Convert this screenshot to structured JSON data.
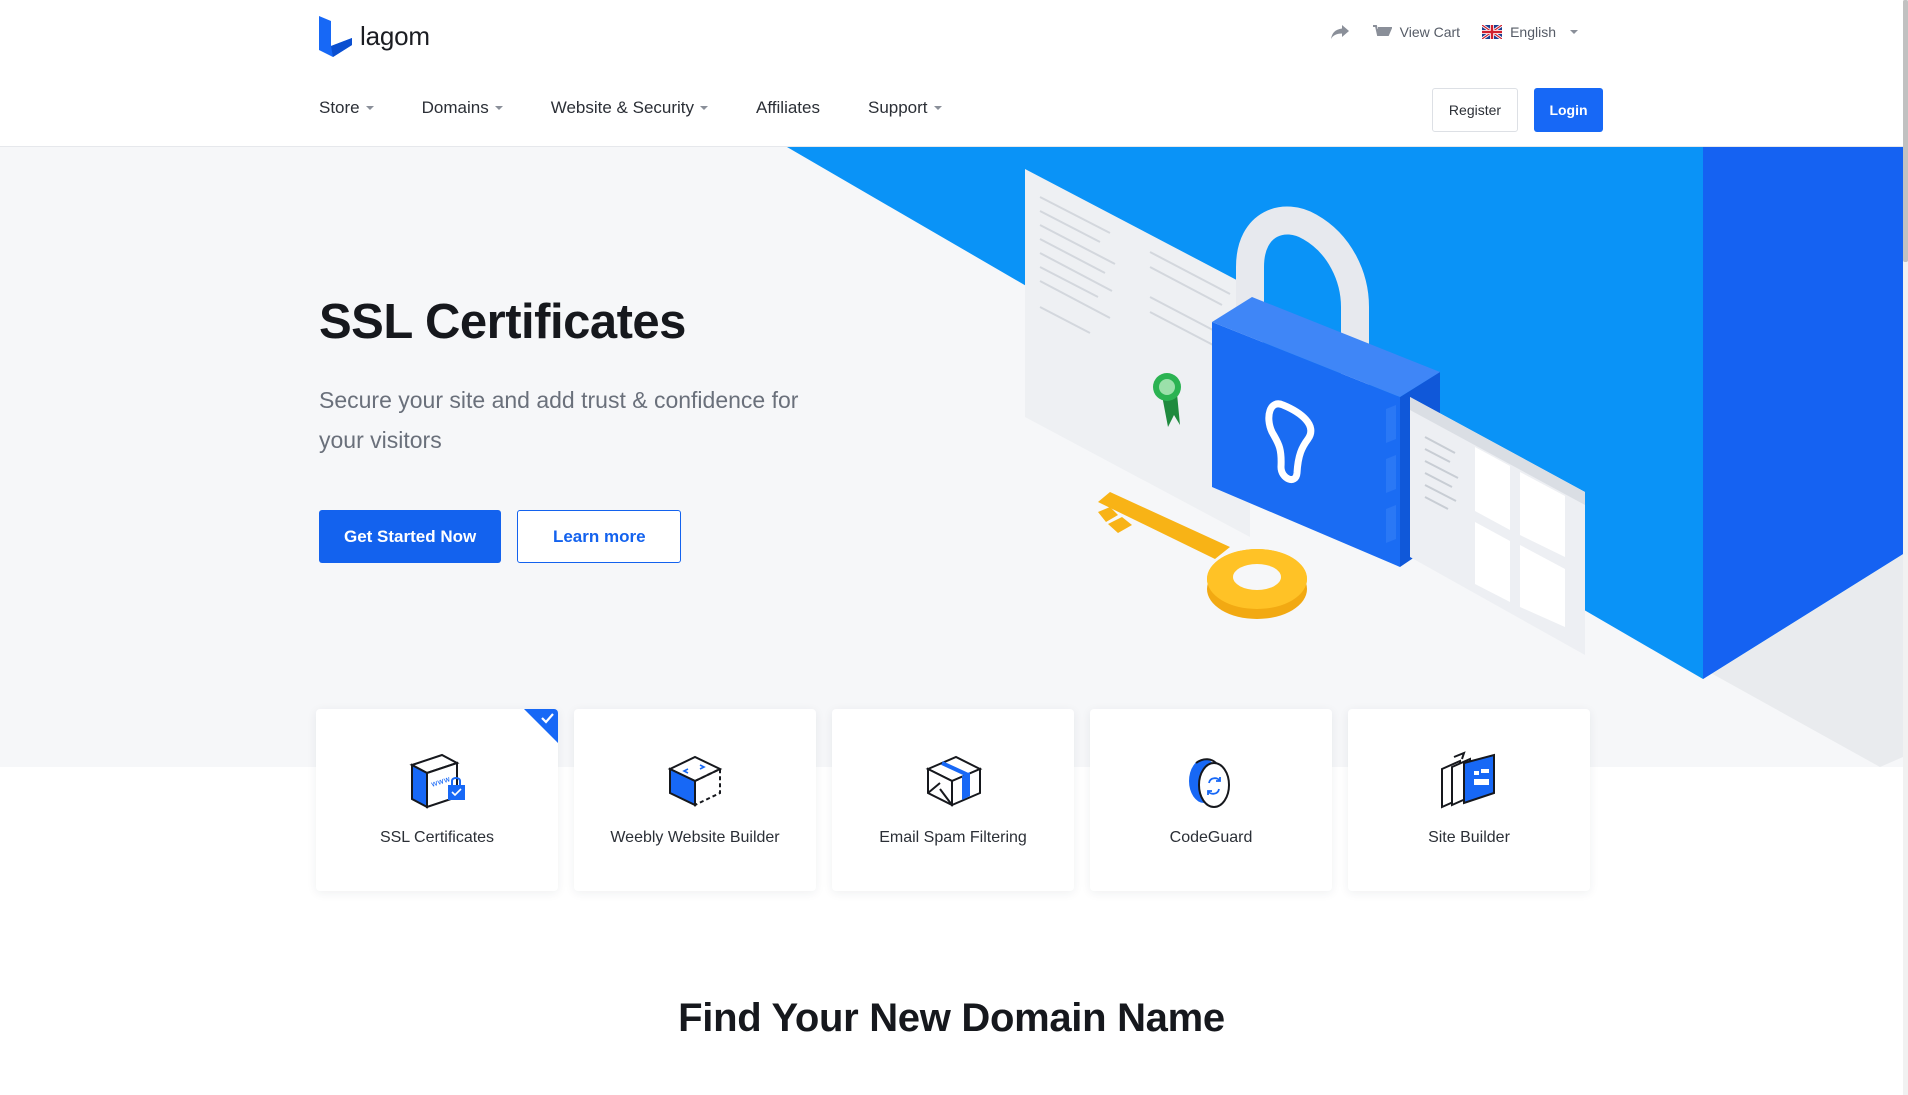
{
  "brand": {
    "name": "lagom",
    "accent": "#1768f6"
  },
  "topbar": {
    "view_cart_label": "View Cart",
    "language_label": "English"
  },
  "nav": {
    "items": [
      {
        "label": "Store",
        "has_dropdown": true
      },
      {
        "label": "Domains",
        "has_dropdown": true
      },
      {
        "label": "Website & Security",
        "has_dropdown": true
      },
      {
        "label": "Affiliates",
        "has_dropdown": false
      },
      {
        "label": "Support",
        "has_dropdown": true
      }
    ],
    "register_label": "Register",
    "login_label": "Login"
  },
  "hero": {
    "title": "SSL Certificates",
    "subtitle": "Secure your site and add trust & confidence for your visitors",
    "primary_cta": "Get Started Now",
    "secondary_cta": "Learn more"
  },
  "products": [
    {
      "label": "SSL Certificates",
      "icon": "ssl-certificate-icon",
      "selected": true
    },
    {
      "label": "Weebly Website Builder",
      "icon": "website-builder-icon",
      "selected": false
    },
    {
      "label": "Email Spam Filtering",
      "icon": "email-envelope-icon",
      "selected": false
    },
    {
      "label": "CodeGuard",
      "icon": "codeguard-icon",
      "selected": false
    },
    {
      "label": "Site Builder",
      "icon": "site-builder-icon",
      "selected": false
    }
  ],
  "domain_section": {
    "title": "Find Your New Domain Name"
  }
}
